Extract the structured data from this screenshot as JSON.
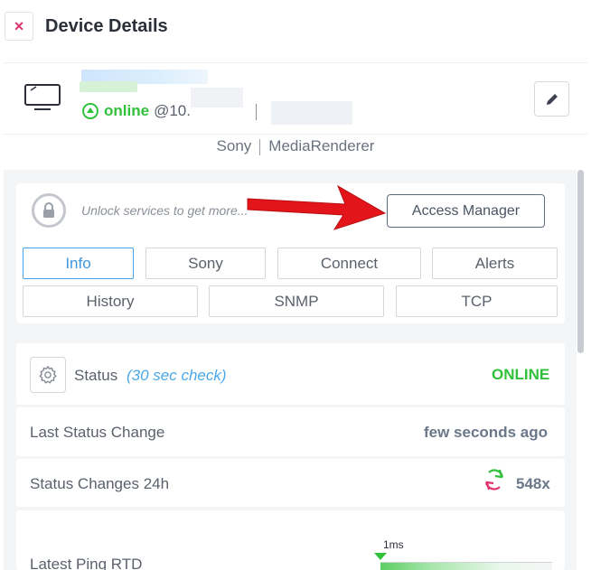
{
  "header": {
    "close_label": "×",
    "title": "Device Details"
  },
  "device": {
    "status_word": "online",
    "ip_prefix": "@10.",
    "vendor": "Sony",
    "model": "MediaRenderer"
  },
  "unlock": {
    "text": "Unlock services to get more...",
    "button_label": "Access Manager"
  },
  "tabs": {
    "row1": [
      "Info",
      "Sony",
      "Connect",
      "Alerts"
    ],
    "row2": [
      "History",
      "SNMP",
      "TCP"
    ],
    "active": "Info"
  },
  "status": {
    "label": "Status",
    "check_note": "(30 sec check)",
    "value": "ONLINE"
  },
  "last_change": {
    "label": "Last Status Change",
    "value": "few seconds ago"
  },
  "changes_24h": {
    "label": "Status Changes 24h",
    "value": "548x"
  },
  "ping": {
    "label": "Latest Ping RTD",
    "marker_label": "1ms"
  },
  "colors": {
    "online": "#31c13a",
    "accent_blue": "#4aa3e8",
    "close_pink": "#e0336f",
    "arrow_red": "#e3151a"
  }
}
